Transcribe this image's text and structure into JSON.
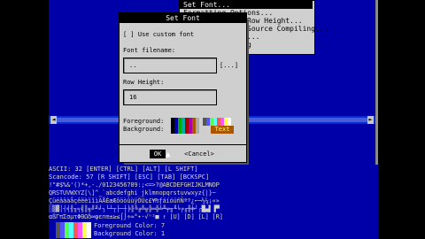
{
  "menu": {
    "items": [
      {
        "label": "Set Font...",
        "selected": true
      },
      {
        "label": "Formatting Options...",
        "selected": false
      },
      {
        "label": "Row Height...",
        "selected": false
      },
      {
        "label": "Source Compiling...",
        "selected": false
      },
      {
        "label": "...",
        "selected": false
      },
      {
        "label": "g",
        "selected": false
      }
    ]
  },
  "dialog": {
    "title": "Set Font",
    "custom_font_checkbox": "[ ] Use custom font",
    "font_filename_label": "Font filename:",
    "font_filename_value": "..",
    "browse_label": "[...]",
    "row_height_label": "Row Height:",
    "row_height_value": "16",
    "foreground_label": "Foreground:",
    "background_label": "Background:",
    "sample_text": "Text",
    "ok_label": "OK",
    "cancel_label": "<Cancel>"
  },
  "status": {
    "ascii_line": "ASCII:  32       [ENTER]  [CTRL]   [ALT]  [L SHIFT]",
    "scancode_line": "Scancode: 57    [R SHIFT]  [ESC]  [TAB]  [BCKSPC]",
    "foreground_color": "Foreground Color: 7",
    "background_color": "Background Color: 1"
  },
  "charset": {
    "row1": " !\"#$%&'()*+,-./0123456789:;<=>?@ABCDEFGHIJKLMNOP",
    "row2": "QRSTUVWXYZ[\\]^_`abcdefghi jklmnopqrstuvwxyz{|}~",
    "row3": "ÇüéâäàåçêëèïîìÄÅÉæÆôöòûùÿÖÜ¢£¥₧ƒáíóúñÑªº¿⌐¬½¼¡«»",
    "row4": "░▒▓│┤╡╢╖╕╣║╗╝╜╛┐└┴┬├─┼╞╟╚╔╩╦╠═╬╧╨╤╥╙╘╒╓╫╪┘┌█▄▌▐▀",
    "row5": "αßΓπΣσµτΦΘΩδ∞φε∩≡±≥≤⌠⌡÷≈°∙·√ⁿ²■  ↑ [U]  [D]  [L]  [R]"
  },
  "colors": {
    "screen_blue": "#0000a8",
    "dialog_gray": "#cfcfcf",
    "palette": [
      "#000000",
      "#0000aa",
      "#00aa00",
      "#00aaaa",
      "#aa0000",
      "#aa00aa",
      "#aa5500",
      "#aaaaaa",
      "#555555",
      "#5555ff",
      "#55ff55",
      "#55ffff",
      "#ff5555",
      "#ff55ff",
      "#ffff55",
      "#ffffff"
    ]
  }
}
